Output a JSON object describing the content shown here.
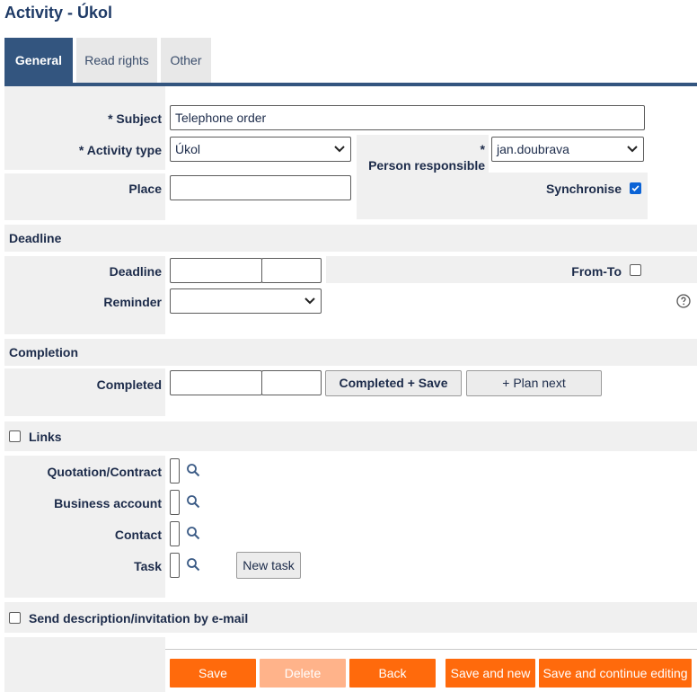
{
  "page": {
    "title": "Activity - Úkol"
  },
  "tabs": [
    {
      "label": "General"
    },
    {
      "label": "Read rights"
    },
    {
      "label": "Other"
    }
  ],
  "general": {
    "subject_label": "* Subject",
    "subject_value": "Telephone order",
    "activity_type_label": "* Activity type",
    "activity_type_value": "Úkol",
    "person_responsible_star": "*",
    "person_responsible_label": "Person responsible",
    "person_responsible_value": "jan.doubrava",
    "place_label": "Place",
    "place_value": "",
    "synchronise_label": "Synchronise",
    "synchronise_checked": true
  },
  "deadline": {
    "section_title": "Deadline",
    "deadline_label": "Deadline",
    "deadline_date": "",
    "deadline_time": "",
    "from_to_label": "From-To",
    "reminder_label": "Reminder",
    "reminder_value": ""
  },
  "completion": {
    "section_title": "Completion",
    "completed_label": "Completed",
    "completed_save_label": "Completed + Save",
    "plan_next_label": "+ Plan next"
  },
  "links": {
    "section_title": "Links",
    "quotation_label": "Quotation/Contract",
    "business_account_label": "Business account",
    "contact_label": "Contact",
    "task_label": "Task",
    "new_task_label": "New task"
  },
  "email": {
    "section_title": "Send description/invitation by e-mail"
  },
  "footer": {
    "save_label": "Save",
    "delete_label": "Delete",
    "back_label": "Back",
    "save_new_label": "Save and new",
    "save_continue_label": "Save and continue editing"
  },
  "colors": {
    "accent": "#33557f",
    "orange": "#ff6a0c",
    "orange_disabled": "#ffb38a",
    "panel_gray": "#f0f0f0"
  }
}
